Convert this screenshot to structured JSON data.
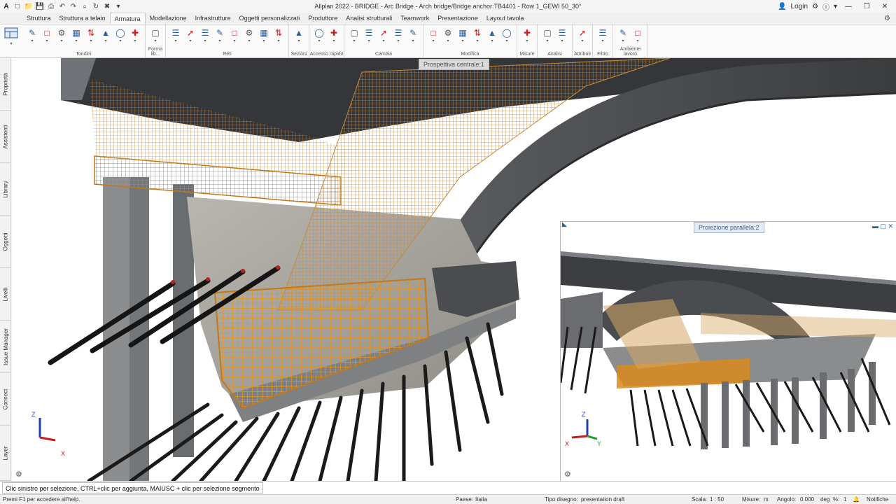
{
  "window": {
    "title": "Allplan 2022 - BRIDGE - Arc Bridge - Arch bridge/Bridge anchor:TB4401 - Row 1_GEWI 50_30°",
    "login_label": "Login"
  },
  "quick_access": [
    "app-logo",
    "new",
    "open",
    "save",
    "print",
    "undo",
    "redo",
    "zoom",
    "refresh",
    "tools",
    "more"
  ],
  "tabs": [
    "Struttura",
    "Struttura a telaio",
    "Armatura",
    "Modellazione",
    "Infrastrutture",
    "Oggetti personalizzati",
    "Produttore",
    "Analisi strutturali",
    "Teamwork",
    "Presentazione",
    "Layout tavola"
  ],
  "active_tab": "Armatura",
  "ribbon": {
    "groups": [
      {
        "label": "Tondini",
        "icon_count": 8
      },
      {
        "label": "Forma lib...",
        "icon_count": 1
      },
      {
        "label": "Reti",
        "icon_count": 8
      },
      {
        "label": "Sezioni",
        "icon_count": 1
      },
      {
        "label": "Accesso rapido",
        "icon_count": 2
      },
      {
        "label": "Cambia",
        "icon_count": 5
      },
      {
        "label": "Modifica",
        "icon_count": 6
      },
      {
        "label": "Misure",
        "icon_count": 1
      },
      {
        "label": "Analisi",
        "icon_count": 2
      },
      {
        "label": "Attributi",
        "icon_count": 1
      },
      {
        "label": "Filtro",
        "icon_count": 1
      },
      {
        "label": "Ambiente lavoro",
        "icon_count": 2
      }
    ]
  },
  "left_dock": [
    "Proprietà",
    "Assistenti",
    "Library",
    "Oggetti",
    "Livelli",
    "Issue Manager",
    "Connect",
    "Layer"
  ],
  "viewports": {
    "main_title": "Prospettiva centrale:1",
    "secondary_title": "Proiezione parallela:2"
  },
  "axes": {
    "x": "X",
    "y": "Y",
    "z": "Z"
  },
  "colors": {
    "rebar": "#d98a1c",
    "concrete": "#8a8c8e",
    "deck": "#3d3f42",
    "pile": "#1c1c1c",
    "axis_x": "#c8191e",
    "axis_y": "#2f9a2f",
    "axis_z": "#1f3fb0"
  },
  "command_line": "Clic sinistro per selezione, CTRL+clic per aggiunta, MAIUSC + clic per selezione segmento",
  "status": {
    "help": "Premi F1 per accedere all'help.",
    "country_label": "Paese:",
    "country_value": "Italia",
    "drawing_type_label": "Tipo disegno:",
    "drawing_type_value": "presentation draft",
    "scale_label": "Scala:",
    "scale_value": "1 : 50",
    "length_label": "Misure:",
    "length_value": "m",
    "angle_label": "Angolo:",
    "angle_value": "0.000",
    "angle_unit": "deg",
    "percent_label": "%:",
    "percent_value": "1",
    "notifications": "Notifiche"
  }
}
